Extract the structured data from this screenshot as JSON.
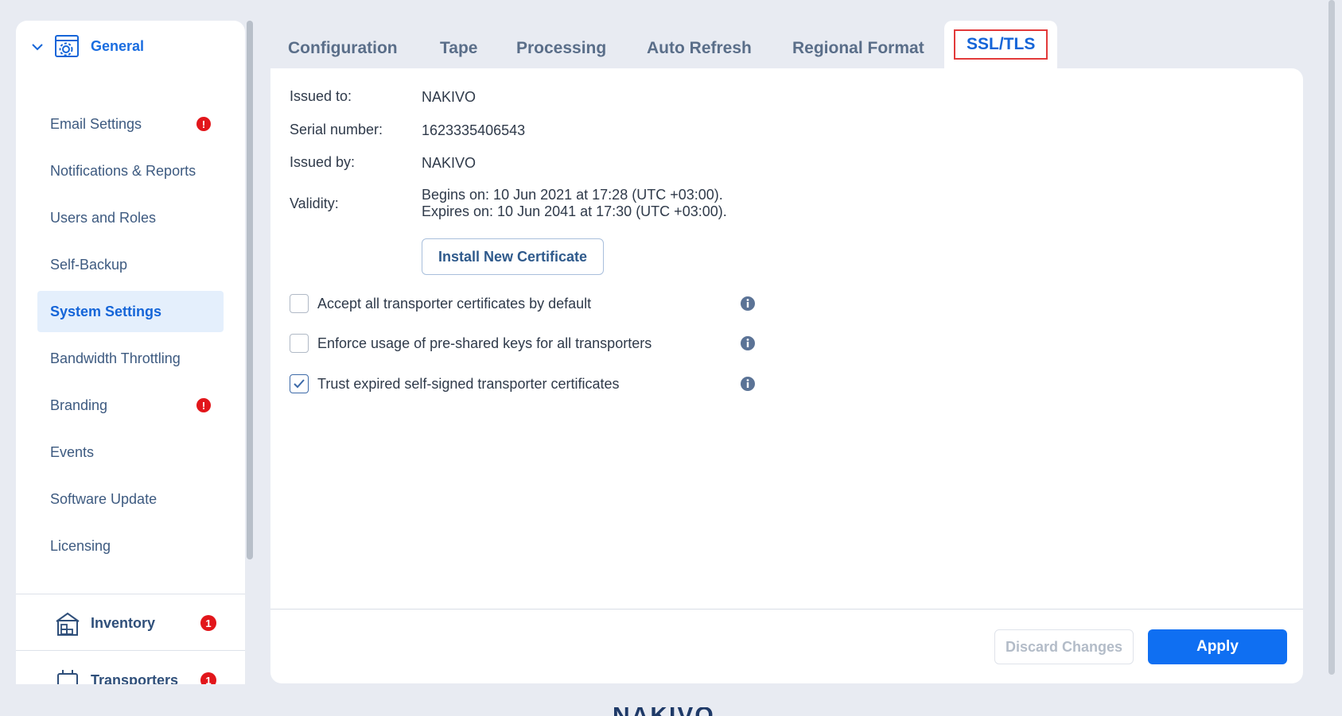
{
  "sidebar": {
    "general": {
      "title": "General",
      "icon": "gear-window-icon",
      "chevron": "chevron-down-icon"
    },
    "items": [
      {
        "label": "Email Settings",
        "alert": "!"
      },
      {
        "label": "Notifications & Reports"
      },
      {
        "label": "Users and Roles"
      },
      {
        "label": "Self-Backup"
      },
      {
        "label": "System Settings",
        "active": true
      },
      {
        "label": "Bandwidth Throttling"
      },
      {
        "label": "Branding",
        "alert": "!"
      },
      {
        "label": "Events"
      },
      {
        "label": "Software Update"
      },
      {
        "label": "Licensing"
      }
    ],
    "inventory": {
      "title": "Inventory",
      "count": "1",
      "icon": "inventory-icon"
    },
    "transporters": {
      "title": "Transporters",
      "count": "1",
      "icon": "transporter-icon"
    }
  },
  "tabs": [
    "Configuration",
    "Tape",
    "Processing",
    "Auto Refresh",
    "Regional Format",
    "SSL/TLS"
  ],
  "active_tab": "SSL/TLS",
  "certificate": {
    "issued_to_label": "Issued to:",
    "issued_to": "NAKIVO",
    "serial_label": "Serial number:",
    "serial": "1623335406543",
    "issued_by_label": "Issued by:",
    "issued_by": "NAKIVO",
    "validity_label": "Validity:",
    "begins": "Begins on: 10 Jun 2021 at 17:28 (UTC +03:00).",
    "expires": "Expires on: 10 Jun 2041 at 17:30 (UTC +03:00).",
    "install_button": "Install New Certificate"
  },
  "options": [
    {
      "label": "Accept all transporter certificates by default",
      "checked": false
    },
    {
      "label": "Enforce usage of pre-shared keys for all transporters",
      "checked": false
    },
    {
      "label": "Trust expired self-signed transporter certificates",
      "checked": true
    }
  ],
  "footer": {
    "discard": "Discard Changes",
    "apply": "Apply",
    "brand": "NAKIVO"
  },
  "colors": {
    "accent": "#1565d8",
    "apply_bg": "#0f6ff2",
    "alert": "#e2161b",
    "highlight_border": "#e23a3a"
  }
}
